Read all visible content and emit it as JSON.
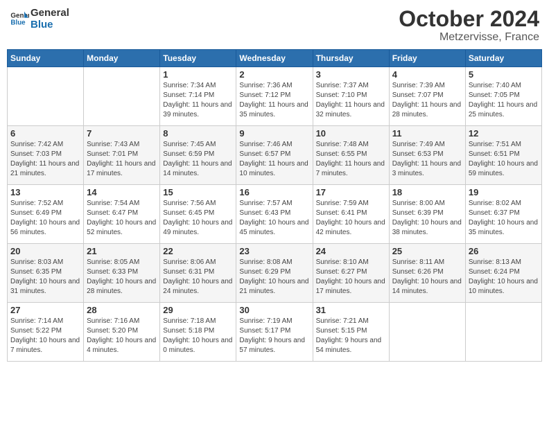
{
  "logo": {
    "line1": "General",
    "line2": "Blue"
  },
  "title": "October 2024",
  "location": "Metzervisse, France",
  "weekdays": [
    "Sunday",
    "Monday",
    "Tuesday",
    "Wednesday",
    "Thursday",
    "Friday",
    "Saturday"
  ],
  "weeks": [
    [
      {
        "day": "",
        "sunrise": "",
        "sunset": "",
        "daylight": ""
      },
      {
        "day": "",
        "sunrise": "",
        "sunset": "",
        "daylight": ""
      },
      {
        "day": "1",
        "sunrise": "Sunrise: 7:34 AM",
        "sunset": "Sunset: 7:14 PM",
        "daylight": "Daylight: 11 hours and 39 minutes."
      },
      {
        "day": "2",
        "sunrise": "Sunrise: 7:36 AM",
        "sunset": "Sunset: 7:12 PM",
        "daylight": "Daylight: 11 hours and 35 minutes."
      },
      {
        "day": "3",
        "sunrise": "Sunrise: 7:37 AM",
        "sunset": "Sunset: 7:10 PM",
        "daylight": "Daylight: 11 hours and 32 minutes."
      },
      {
        "day": "4",
        "sunrise": "Sunrise: 7:39 AM",
        "sunset": "Sunset: 7:07 PM",
        "daylight": "Daylight: 11 hours and 28 minutes."
      },
      {
        "day": "5",
        "sunrise": "Sunrise: 7:40 AM",
        "sunset": "Sunset: 7:05 PM",
        "daylight": "Daylight: 11 hours and 25 minutes."
      }
    ],
    [
      {
        "day": "6",
        "sunrise": "Sunrise: 7:42 AM",
        "sunset": "Sunset: 7:03 PM",
        "daylight": "Daylight: 11 hours and 21 minutes."
      },
      {
        "day": "7",
        "sunrise": "Sunrise: 7:43 AM",
        "sunset": "Sunset: 7:01 PM",
        "daylight": "Daylight: 11 hours and 17 minutes."
      },
      {
        "day": "8",
        "sunrise": "Sunrise: 7:45 AM",
        "sunset": "Sunset: 6:59 PM",
        "daylight": "Daylight: 11 hours and 14 minutes."
      },
      {
        "day": "9",
        "sunrise": "Sunrise: 7:46 AM",
        "sunset": "Sunset: 6:57 PM",
        "daylight": "Daylight: 11 hours and 10 minutes."
      },
      {
        "day": "10",
        "sunrise": "Sunrise: 7:48 AM",
        "sunset": "Sunset: 6:55 PM",
        "daylight": "Daylight: 11 hours and 7 minutes."
      },
      {
        "day": "11",
        "sunrise": "Sunrise: 7:49 AM",
        "sunset": "Sunset: 6:53 PM",
        "daylight": "Daylight: 11 hours and 3 minutes."
      },
      {
        "day": "12",
        "sunrise": "Sunrise: 7:51 AM",
        "sunset": "Sunset: 6:51 PM",
        "daylight": "Daylight: 10 hours and 59 minutes."
      }
    ],
    [
      {
        "day": "13",
        "sunrise": "Sunrise: 7:52 AM",
        "sunset": "Sunset: 6:49 PM",
        "daylight": "Daylight: 10 hours and 56 minutes."
      },
      {
        "day": "14",
        "sunrise": "Sunrise: 7:54 AM",
        "sunset": "Sunset: 6:47 PM",
        "daylight": "Daylight: 10 hours and 52 minutes."
      },
      {
        "day": "15",
        "sunrise": "Sunrise: 7:56 AM",
        "sunset": "Sunset: 6:45 PM",
        "daylight": "Daylight: 10 hours and 49 minutes."
      },
      {
        "day": "16",
        "sunrise": "Sunrise: 7:57 AM",
        "sunset": "Sunset: 6:43 PM",
        "daylight": "Daylight: 10 hours and 45 minutes."
      },
      {
        "day": "17",
        "sunrise": "Sunrise: 7:59 AM",
        "sunset": "Sunset: 6:41 PM",
        "daylight": "Daylight: 10 hours and 42 minutes."
      },
      {
        "day": "18",
        "sunrise": "Sunrise: 8:00 AM",
        "sunset": "Sunset: 6:39 PM",
        "daylight": "Daylight: 10 hours and 38 minutes."
      },
      {
        "day": "19",
        "sunrise": "Sunrise: 8:02 AM",
        "sunset": "Sunset: 6:37 PM",
        "daylight": "Daylight: 10 hours and 35 minutes."
      }
    ],
    [
      {
        "day": "20",
        "sunrise": "Sunrise: 8:03 AM",
        "sunset": "Sunset: 6:35 PM",
        "daylight": "Daylight: 10 hours and 31 minutes."
      },
      {
        "day": "21",
        "sunrise": "Sunrise: 8:05 AM",
        "sunset": "Sunset: 6:33 PM",
        "daylight": "Daylight: 10 hours and 28 minutes."
      },
      {
        "day": "22",
        "sunrise": "Sunrise: 8:06 AM",
        "sunset": "Sunset: 6:31 PM",
        "daylight": "Daylight: 10 hours and 24 minutes."
      },
      {
        "day": "23",
        "sunrise": "Sunrise: 8:08 AM",
        "sunset": "Sunset: 6:29 PM",
        "daylight": "Daylight: 10 hours and 21 minutes."
      },
      {
        "day": "24",
        "sunrise": "Sunrise: 8:10 AM",
        "sunset": "Sunset: 6:27 PM",
        "daylight": "Daylight: 10 hours and 17 minutes."
      },
      {
        "day": "25",
        "sunrise": "Sunrise: 8:11 AM",
        "sunset": "Sunset: 6:26 PM",
        "daylight": "Daylight: 10 hours and 14 minutes."
      },
      {
        "day": "26",
        "sunrise": "Sunrise: 8:13 AM",
        "sunset": "Sunset: 6:24 PM",
        "daylight": "Daylight: 10 hours and 10 minutes."
      }
    ],
    [
      {
        "day": "27",
        "sunrise": "Sunrise: 7:14 AM",
        "sunset": "Sunset: 5:22 PM",
        "daylight": "Daylight: 10 hours and 7 minutes."
      },
      {
        "day": "28",
        "sunrise": "Sunrise: 7:16 AM",
        "sunset": "Sunset: 5:20 PM",
        "daylight": "Daylight: 10 hours and 4 minutes."
      },
      {
        "day": "29",
        "sunrise": "Sunrise: 7:18 AM",
        "sunset": "Sunset: 5:18 PM",
        "daylight": "Daylight: 10 hours and 0 minutes."
      },
      {
        "day": "30",
        "sunrise": "Sunrise: 7:19 AM",
        "sunset": "Sunset: 5:17 PM",
        "daylight": "Daylight: 9 hours and 57 minutes."
      },
      {
        "day": "31",
        "sunrise": "Sunrise: 7:21 AM",
        "sunset": "Sunset: 5:15 PM",
        "daylight": "Daylight: 9 hours and 54 minutes."
      },
      {
        "day": "",
        "sunrise": "",
        "sunset": "",
        "daylight": ""
      },
      {
        "day": "",
        "sunrise": "",
        "sunset": "",
        "daylight": ""
      }
    ]
  ]
}
